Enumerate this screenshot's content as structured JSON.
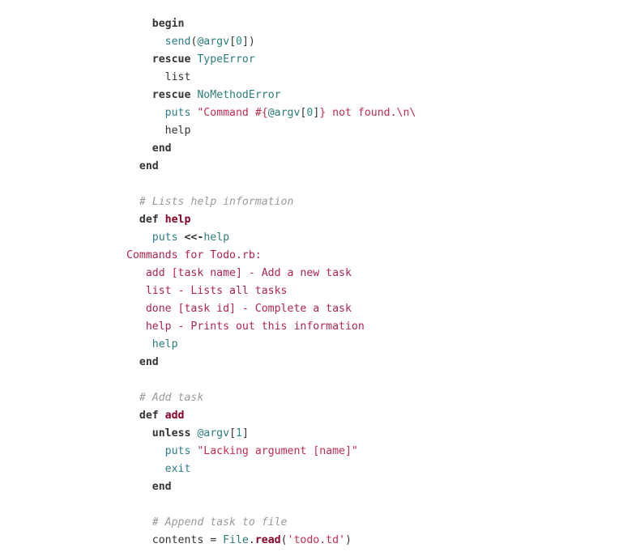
{
  "code": {
    "language": "ruby",
    "lines": [
      {
        "indent": "    ",
        "tokens": [
          {
            "t": "kw",
            "v": "begin"
          }
        ]
      },
      {
        "indent": "      ",
        "tokens": [
          {
            "t": "bi",
            "v": "send"
          },
          {
            "t": "pl",
            "v": "("
          },
          {
            "t": "iv",
            "v": "@argv"
          },
          {
            "t": "pl",
            "v": "["
          },
          {
            "t": "num",
            "v": "0"
          },
          {
            "t": "pl",
            "v": "])"
          }
        ]
      },
      {
        "indent": "    ",
        "tokens": [
          {
            "t": "kw",
            "v": "rescue"
          },
          {
            "t": "pl",
            "v": " "
          },
          {
            "t": "cn",
            "v": "TypeError"
          }
        ]
      },
      {
        "indent": "      ",
        "tokens": [
          {
            "t": "pl",
            "v": "list"
          }
        ]
      },
      {
        "indent": "    ",
        "tokens": [
          {
            "t": "kw",
            "v": "rescue"
          },
          {
            "t": "pl",
            "v": " "
          },
          {
            "t": "cn",
            "v": "NoMethodError"
          }
        ]
      },
      {
        "indent": "      ",
        "tokens": [
          {
            "t": "bi",
            "v": "puts"
          },
          {
            "t": "pl",
            "v": " "
          },
          {
            "t": "str",
            "v": "\"Command #{"
          },
          {
            "t": "iv",
            "v": "@argv"
          },
          {
            "t": "pl",
            "v": "["
          },
          {
            "t": "num",
            "v": "0"
          },
          {
            "t": "pl",
            "v": "]"
          },
          {
            "t": "str",
            "v": "} not found.\\n\\"
          }
        ]
      },
      {
        "indent": "      ",
        "tokens": [
          {
            "t": "pl",
            "v": "help"
          }
        ]
      },
      {
        "indent": "    ",
        "tokens": [
          {
            "t": "kw",
            "v": "end"
          }
        ]
      },
      {
        "indent": "  ",
        "tokens": [
          {
            "t": "kw",
            "v": "end"
          }
        ]
      },
      {
        "indent": "",
        "tokens": []
      },
      {
        "indent": "  ",
        "tokens": [
          {
            "t": "cm",
            "v": "# Lists help information"
          }
        ]
      },
      {
        "indent": "  ",
        "tokens": [
          {
            "t": "kw",
            "v": "def"
          },
          {
            "t": "pl",
            "v": " "
          },
          {
            "t": "fn",
            "v": "help"
          }
        ]
      },
      {
        "indent": "    ",
        "tokens": [
          {
            "t": "bi",
            "v": "puts"
          },
          {
            "t": "pl",
            "v": " "
          },
          {
            "t": "kw",
            "v": "<<-"
          },
          {
            "t": "ob",
            "v": "help"
          }
        ]
      },
      {
        "indent": "",
        "tokens": [
          {
            "t": "hd",
            "v": "Commands for Todo.rb:"
          }
        ]
      },
      {
        "indent": "   ",
        "tokens": [
          {
            "t": "hd",
            "v": "add [task name] - Add a new task"
          }
        ]
      },
      {
        "indent": "   ",
        "tokens": [
          {
            "t": "hd",
            "v": "list - Lists all tasks"
          }
        ]
      },
      {
        "indent": "   ",
        "tokens": [
          {
            "t": "hd",
            "v": "done [task id] - Complete a task"
          }
        ]
      },
      {
        "indent": "   ",
        "tokens": [
          {
            "t": "hd",
            "v": "help - Prints out this information"
          }
        ]
      },
      {
        "indent": "    ",
        "tokens": [
          {
            "t": "ob",
            "v": "help"
          }
        ]
      },
      {
        "indent": "  ",
        "tokens": [
          {
            "t": "kw",
            "v": "end"
          }
        ]
      },
      {
        "indent": "",
        "tokens": []
      },
      {
        "indent": "  ",
        "tokens": [
          {
            "t": "cm",
            "v": "# Add task"
          }
        ]
      },
      {
        "indent": "  ",
        "tokens": [
          {
            "t": "kw",
            "v": "def"
          },
          {
            "t": "pl",
            "v": " "
          },
          {
            "t": "fn",
            "v": "add"
          }
        ]
      },
      {
        "indent": "    ",
        "tokens": [
          {
            "t": "kw",
            "v": "unless"
          },
          {
            "t": "pl",
            "v": " "
          },
          {
            "t": "iv",
            "v": "@argv"
          },
          {
            "t": "pl",
            "v": "["
          },
          {
            "t": "num",
            "v": "1"
          },
          {
            "t": "pl",
            "v": "]"
          }
        ]
      },
      {
        "indent": "      ",
        "tokens": [
          {
            "t": "bi",
            "v": "puts"
          },
          {
            "t": "pl",
            "v": " "
          },
          {
            "t": "str",
            "v": "\"Lacking argument [name]\""
          }
        ]
      },
      {
        "indent": "      ",
        "tokens": [
          {
            "t": "bi",
            "v": "exit"
          }
        ]
      },
      {
        "indent": "    ",
        "tokens": [
          {
            "t": "kw",
            "v": "end"
          }
        ]
      },
      {
        "indent": "",
        "tokens": []
      },
      {
        "indent": "    ",
        "tokens": [
          {
            "t": "cm",
            "v": "# Append task to file"
          }
        ]
      },
      {
        "indent": "    ",
        "tokens": [
          {
            "t": "pl",
            "v": "contents = "
          },
          {
            "t": "cn",
            "v": "File"
          },
          {
            "t": "pl",
            "v": "."
          },
          {
            "t": "meth",
            "v": "read"
          },
          {
            "t": "pl",
            "v": "("
          },
          {
            "t": "str",
            "v": "'todo.td'"
          },
          {
            "t": "pl",
            "v": ")"
          }
        ]
      }
    ]
  }
}
